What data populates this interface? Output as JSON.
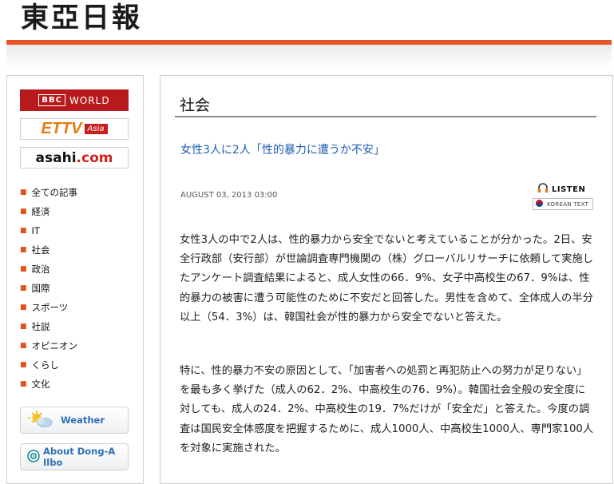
{
  "header": {
    "logo_text": "東亞日報",
    "top_links": [
      "",
      "",
      "",
      ""
    ],
    "accent_color": "#e8542a"
  },
  "sidebar": {
    "partners": {
      "bbc": {
        "mark": "BBC",
        "label": "WORLD"
      },
      "ettv": {
        "label": "ETTV",
        "sub": "Asia"
      },
      "asahi": {
        "prefix": "asahi",
        "suffix": ".com"
      }
    },
    "nav": [
      "全ての記事",
      "経済",
      "IT",
      "社会",
      "政治",
      "国際",
      "スポーツ",
      "社説",
      "オピニオン",
      "くらし",
      "文化"
    ],
    "weather_label": "Weather",
    "about_label": "About Dong-A Ilbo"
  },
  "main": {
    "section_title": "社会",
    "headline": "女性3人に2人「性的暴力に遭うか不安」",
    "date": "AUGUST 03, 2013 03:00",
    "listen_label": "LISTEN",
    "korean_text_label": "KOREAN TEXT",
    "paragraphs": [
      "女性3人の中で2人は、性的暴力から安全でないと考えていることが分かった。2日、安全行政部（安行部）が世論調査専門機関の（株）グローバルリサーチに依頼して実施したアンケート調査結果によると、成人女性の66．9%、女子中高校生の67．9%は、性的暴力の被害に遭う可能性のために不安だと回答した。男性を含めて、全体成人の半分以上（54．3%）は、韓国社会が性的暴力から安全でないと答えた。",
      "特に、性的暴力不安の原因として、「加害者への処罰と再犯防止への努力が足りない」を最も多く挙げた（成人の62．2%、中高校生の76．9%）。韓国社会全般の安全度に対しても、成人の24．2%、中高校生の19．7%だけが「安全だ」と答えた。今度の調査は国民安全体感度を把握するために、成人1000人、中高校生1000人、専門家100人を対象に実施された。"
    ]
  }
}
